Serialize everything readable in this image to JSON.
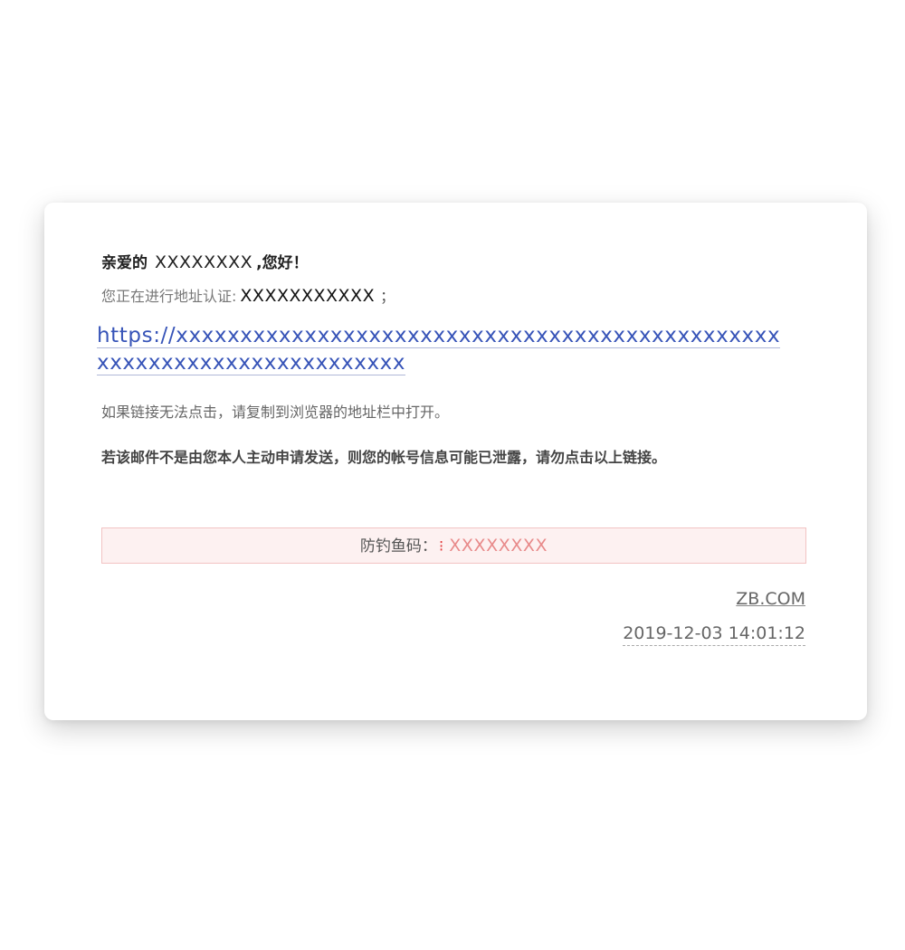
{
  "email": {
    "greeting_prefix": "亲爱的",
    "user_name": "XXXXXXXX",
    "greeting_suffix": ",您好！",
    "verify_label": "您正在进行地址认证:",
    "verify_address": "XXXXXXXXXXX",
    "verify_semicolon": "；",
    "link_text": "https://xxxxxxxxxxxxxxxxxxxxxxxxxxxxxxxxxxxxxxxxxxxxxxxxxxxxxxxxxxxxxxxxxxxxxxx",
    "hint": "如果链接无法点击，请复制到浏览器的地址栏中打开。",
    "warning": "若该邮件不是由您本人主动申请发送，则您的帐号信息可能已泄露，请勿点击以上链接。",
    "anti_phish_label": "防钓鱼码：",
    "anti_phish_mark": "⁝",
    "anti_phish_code": "XXXXXXXX",
    "brand": "ZB.COM",
    "timestamp": "2019-12-03 14:01:12"
  },
  "colors": {
    "link": "#3754b8",
    "anti_phish_bg": "#fdf1f1",
    "anti_phish_border": "#f2c3c3",
    "anti_phish_code": "#e88a8a"
  }
}
